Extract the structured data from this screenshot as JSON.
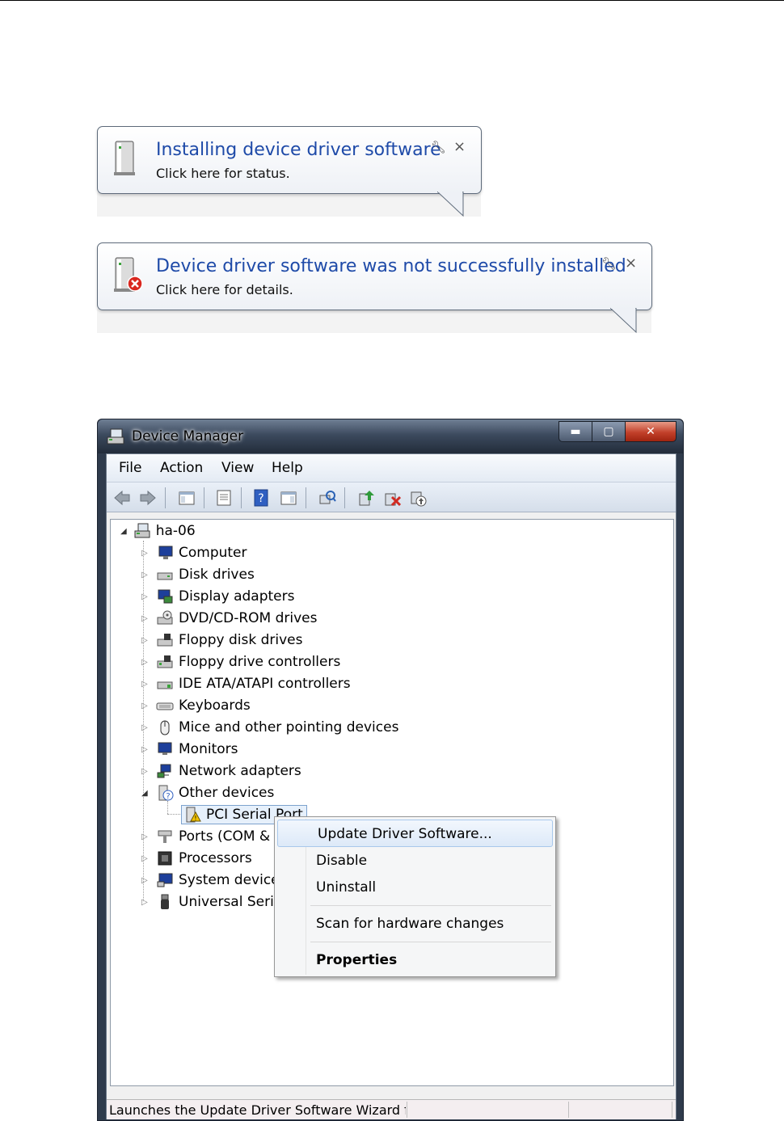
{
  "balloons": [
    {
      "title": "Installing device driver software",
      "subtitle": "Click here for status.",
      "icon": "device-icon",
      "wrench_icon": "wrench-icon",
      "close": "×"
    },
    {
      "title": "Device driver software was not successfully installed",
      "subtitle": "Click here for details.",
      "icon": "device-error-icon",
      "wrench_icon": "wrench-icon",
      "close": "×"
    }
  ],
  "window": {
    "title": "Device Manager",
    "caption": {
      "minimize": "▬",
      "maximize": "▢",
      "close": "✕"
    },
    "menu": [
      "File",
      "Action",
      "View",
      "Help"
    ],
    "toolbar_icons": [
      "back-icon",
      "forward-icon",
      "properties-pane-icon",
      "console-icon",
      "help-icon",
      "action-pane-icon",
      "scan-icon",
      "update-driver-icon",
      "uninstall-icon",
      "enable-icon"
    ],
    "tree": {
      "root": "ha-06",
      "categories": [
        "Computer",
        "Disk drives",
        "Display adapters",
        "DVD/CD-ROM drives",
        "Floppy disk drives",
        "Floppy drive controllers",
        "IDE ATA/ATAPI controllers",
        "Keyboards",
        "Mice and other pointing devices",
        "Monitors",
        "Network adapters",
        "Other devices"
      ],
      "other_child": "PCI Serial Port",
      "after": [
        "Ports (COM &",
        "Processors",
        "System device",
        "Universal Seria"
      ]
    },
    "status_text": "Launches the Update Driver Software Wizard fc"
  },
  "context_menu": {
    "items": [
      "Update Driver Software...",
      "Disable",
      "Uninstall",
      "Scan for hardware changes",
      "Properties"
    ]
  }
}
